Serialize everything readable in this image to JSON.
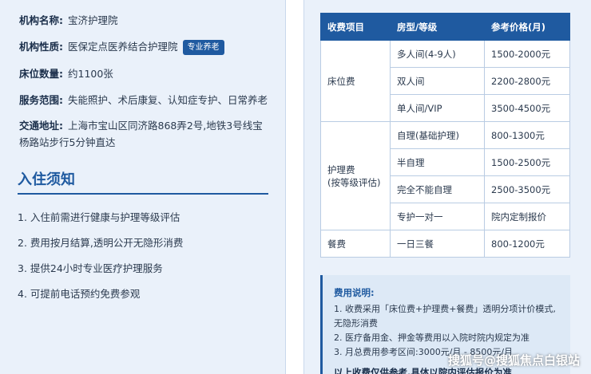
{
  "institution": {
    "name_label": "机构名称:",
    "name_value": "宝济护理院",
    "nature_label": "机构性质:",
    "nature_value": "医保定点医养结合护理院",
    "nature_badge": "专业养老",
    "beds_label": "床位数量:",
    "beds_value": "约1100张",
    "services_label": "服务范围:",
    "services_value": "失能照护、术后康复、认知症专护、日常养老",
    "traffic_label": "交通地址:",
    "traffic_value": "上海市宝山区同济路868弄2号,地铁3号线宝杨路站步行5分钟直达"
  },
  "admission": {
    "title": "入住须知",
    "items": [
      "1. 入住前需进行健康与护理等级评估",
      "2. 费用按月结算,透明公开无隐形消费",
      "3. 提供24小时专业医疗护理服务",
      "4. 可提前电话预约免费参观"
    ]
  },
  "fee_table": {
    "headers": [
      "收费项目",
      "房型/等级",
      "参考价格(月)"
    ],
    "groups": {
      "bed": "床位费",
      "care_line1": "护理费",
      "care_line2": "(按等级评估)",
      "meal": "餐费"
    },
    "rows": [
      {
        "room": "多人间(4-9人)",
        "price": "1500-2000元"
      },
      {
        "room": "双人间",
        "price": "2200-2800元"
      },
      {
        "room": "单人间/VIP",
        "price": "3500-4500元"
      },
      {
        "room": "自理(基础护理)",
        "price": "800-1300元"
      },
      {
        "room": "半自理",
        "price": "1500-2500元"
      },
      {
        "room": "完全不能自理",
        "price": "2500-3500元"
      },
      {
        "room": "专护一对一",
        "price": "院内定制报价"
      },
      {
        "room": "一日三餐",
        "price": "800-1200元"
      }
    ]
  },
  "notes": {
    "title": "费用说明:",
    "line1a": "1. 收费采用「床位费+护理费+餐费」透明分项计价模式,",
    "line1b": "无隐形消费",
    "line2": "2. 医疗备用金、押金等费用以入院时院内规定为准",
    "line3": "3. 月总费用参考区间:3000元/月 - 8500元/月",
    "bold": "以上收费仅供参考,具体以院内评估报价为准"
  },
  "watermark": "搜狐号@搜狐焦点白银站"
}
